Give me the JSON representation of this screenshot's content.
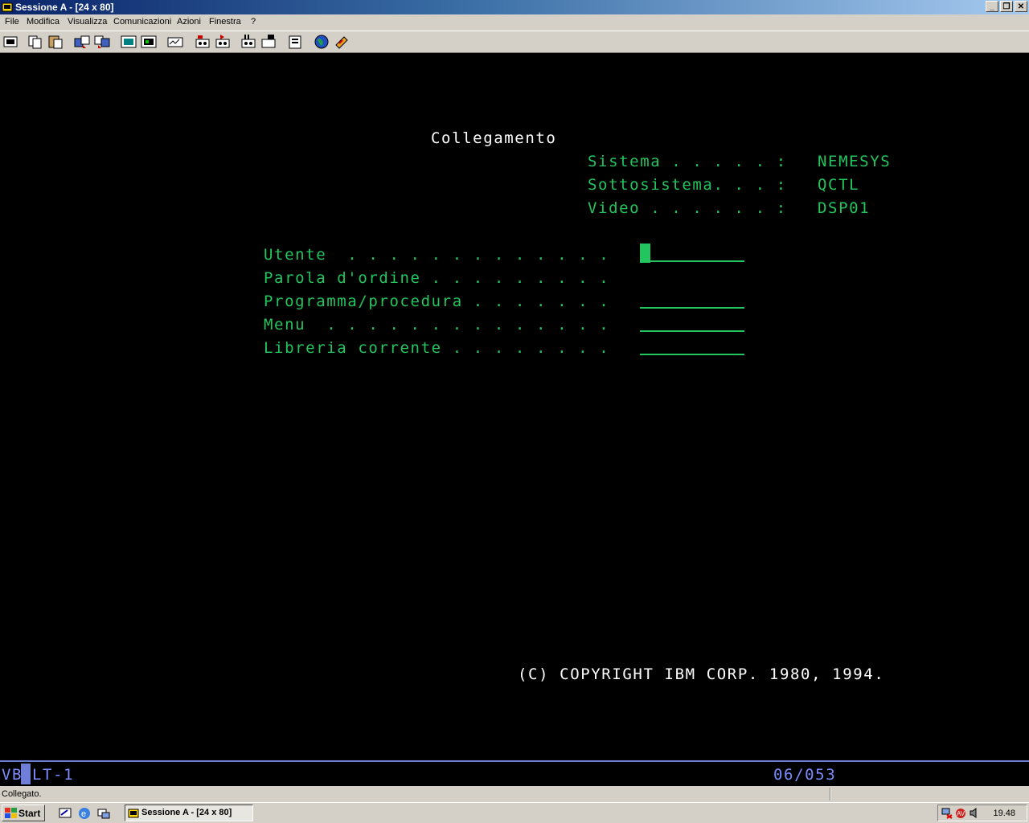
{
  "window": {
    "title": "Sessione A - [24 x 80]",
    "controls": [
      "_",
      "❐",
      "✕"
    ]
  },
  "menu": [
    "File",
    "Modifica",
    "Visualizza",
    "Comunicazioni",
    "Azioni",
    "Finestra",
    "?"
  ],
  "toolbar_icons": [
    "print-screen-icon",
    "copy-icon",
    "paste-icon",
    "send-file-icon",
    "receive-file-icon",
    "display-setup-icon",
    "keyboard-map-icon",
    "macro-icon",
    "record-macro-icon",
    "play-macro-icon",
    "record-icon",
    "stop-icon",
    "print-icon",
    "clipboard-icon",
    "globe-icon",
    "support-icon"
  ],
  "screen": {
    "heading": "Collegamento",
    "info": [
      {
        "label": "Sistema . . . . . :",
        "value": "NEMESYS"
      },
      {
        "label": "Sottosistema. . . :",
        "value": "QCTL"
      },
      {
        "label": "Video . . . . . . :",
        "value": "DSP01"
      }
    ],
    "fields": [
      {
        "label": "Utente  . . . . . . . . . . . . .",
        "value": ""
      },
      {
        "label": "Parola d'ordine . . . . . . . . .",
        "value": ""
      },
      {
        "label": "Programma/procedura . . . . . . .",
        "value": ""
      },
      {
        "label": "Menu  . . . . . . . . . . . . . .",
        "value": ""
      },
      {
        "label": "Libreria corrente . . . . . . . .",
        "value": ""
      }
    ],
    "copyright": "(C) COPYRIGHT IBM CORP. 1980, 1994."
  },
  "oia": {
    "left_prefix": "VB",
    "left_rest": "LT-1",
    "cursor_pos": "06/053"
  },
  "status": {
    "message": "Collegato."
  },
  "taskbar": {
    "start_label": "Start",
    "task_label": "Sessione A - [24 x 80]",
    "clock": "19.48"
  },
  "colors": {
    "terminal_green": "#22c55e",
    "oia_blue": "#7b8cff",
    "title_gradient_start": "#0a246a"
  }
}
